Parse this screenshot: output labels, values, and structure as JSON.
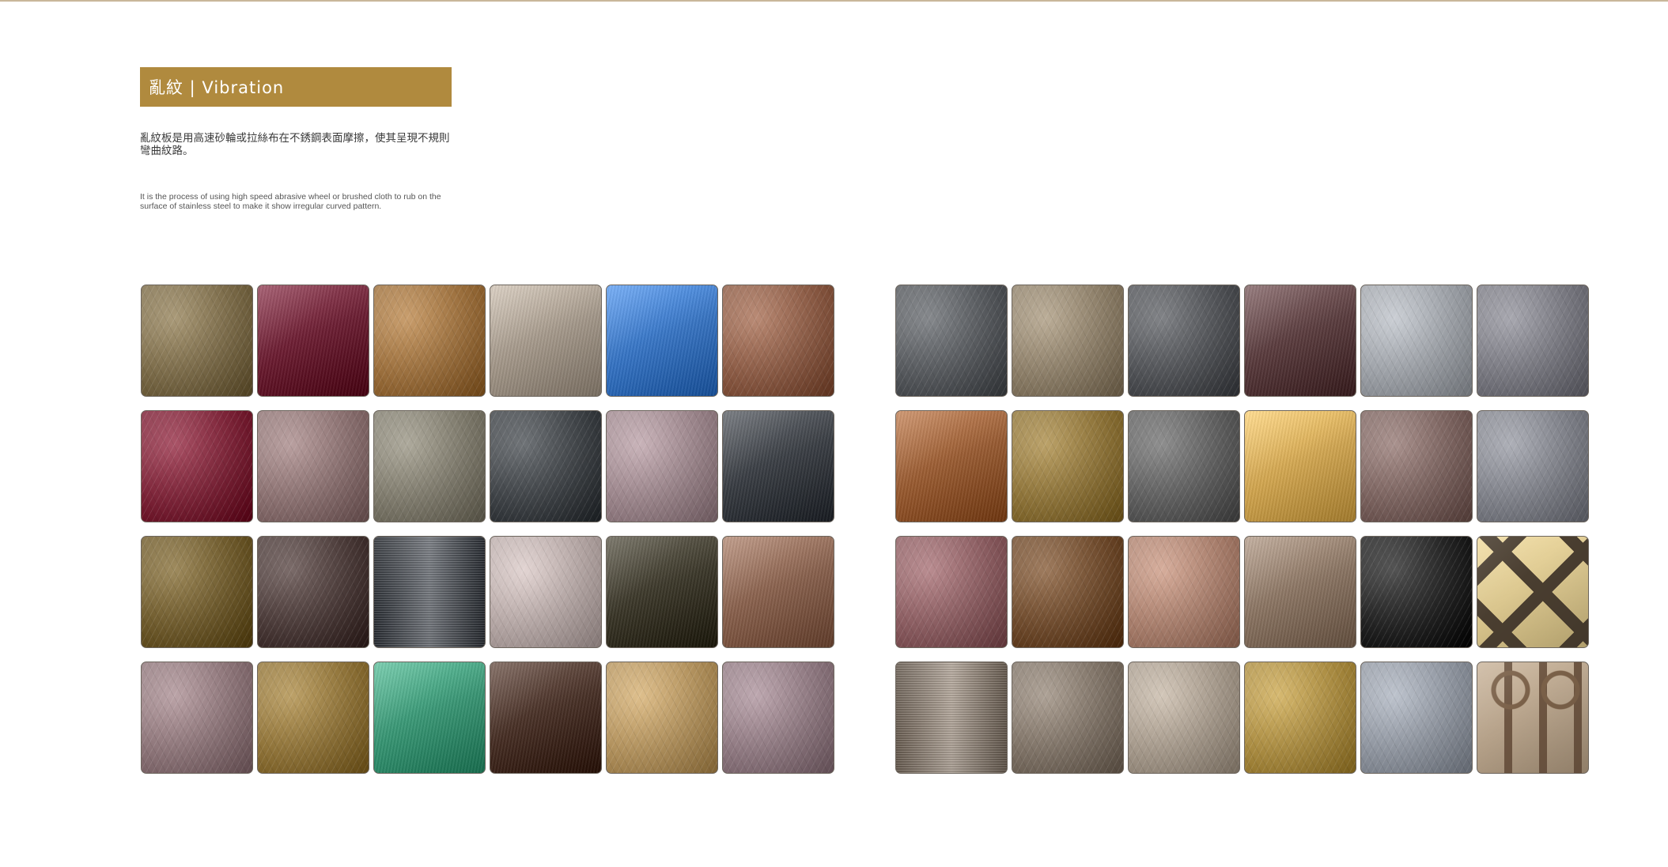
{
  "header": {
    "title": "亂紋 | Vibration",
    "accent_color": "#b08a3e"
  },
  "description": {
    "zh": "亂紋板是用高速砂輪或拉絲布在不銹鋼表面摩擦，使其呈現不規則彎曲紋路。",
    "en": "It is the process of using high speed abrasive wheel or brushed cloth to rub on the surface of stainless steel to make it show irregular curved pattern."
  },
  "swatches_left": [
    {
      "color": "#7a6a48",
      "finish": "swirl"
    },
    {
      "color": "#6e1f34",
      "finish": "brushed"
    },
    {
      "color": "#9a6e3c",
      "finish": "swirl"
    },
    {
      "color": "#a89c8e",
      "finish": "brushed"
    },
    {
      "color": "#3a78c8",
      "finish": "brushed"
    },
    {
      "color": "#8a5a44",
      "finish": "swirl"
    },
    {
      "color": "#7a2236",
      "finish": "swirl"
    },
    {
      "color": "#8a7070",
      "finish": "swirl"
    },
    {
      "color": "#7e7a6c",
      "finish": "swirl"
    },
    {
      "color": "#3e4246",
      "finish": "swirl"
    },
    {
      "color": "#9a848a",
      "finish": "swirl"
    },
    {
      "color": "#3c4046",
      "finish": "brushed"
    },
    {
      "color": "#6e5a2c",
      "finish": "swirl"
    },
    {
      "color": "#4a3a38",
      "finish": "swirl"
    },
    {
      "color": "#4e5258",
      "finish": "linear"
    },
    {
      "color": "#b4a6a4",
      "finish": "swirl"
    },
    {
      "color": "#3e3a2c",
      "finish": "brushed"
    },
    {
      "color": "#8c6450",
      "finish": "brushed"
    },
    {
      "color": "#8c7478",
      "finish": "swirl"
    },
    {
      "color": "#8e7238",
      "finish": "swirl"
    },
    {
      "color": "#3c9a78",
      "finish": "brushed"
    },
    {
      "color": "#4a3228",
      "finish": "brushed"
    },
    {
      "color": "#b0905c",
      "finish": "swirl"
    },
    {
      "color": "#8e7880",
      "finish": "swirl"
    }
  ],
  "swatches_right": [
    {
      "color": "#55585c",
      "finish": "swirl"
    },
    {
      "color": "#8c7e68",
      "finish": "swirl"
    },
    {
      "color": "#505256",
      "finish": "swirl"
    },
    {
      "color": "#5c3e40",
      "finish": "brushed"
    },
    {
      "color": "#9ca0a6",
      "finish": "swirl"
    },
    {
      "color": "#787880",
      "finish": "swirl"
    },
    {
      "color": "#9c5e34",
      "finish": "brushed"
    },
    {
      "color": "#8c7238",
      "finish": "swirl"
    },
    {
      "color": "#5e5e5e",
      "finish": "swirl"
    },
    {
      "color": "#d6aa54",
      "finish": "brushed"
    },
    {
      "color": "#7a625e",
      "finish": "swirl"
    },
    {
      "color": "#7e8088",
      "finish": "swirl"
    },
    {
      "color": "#8a5c60",
      "finish": "swirl"
    },
    {
      "color": "#6e4a2c",
      "finish": "swirl"
    },
    {
      "color": "#a87e6c",
      "finish": "swirl"
    },
    {
      "color": "#8e7866",
      "finish": "brushed"
    },
    {
      "color": "#222222",
      "finish": "swirl"
    },
    {
      "color": "#c4b078",
      "finish": "chevron"
    },
    {
      "color": "#8e8276",
      "finish": "linear"
    },
    {
      "color": "#7e7266",
      "finish": "swirl"
    },
    {
      "color": "#a4988a",
      "finish": "swirl"
    },
    {
      "color": "#a88a40",
      "finish": "swirl"
    },
    {
      "color": "#8e949e",
      "finish": "swirl"
    },
    {
      "color": "#a08c74",
      "finish": "geometric"
    }
  ]
}
